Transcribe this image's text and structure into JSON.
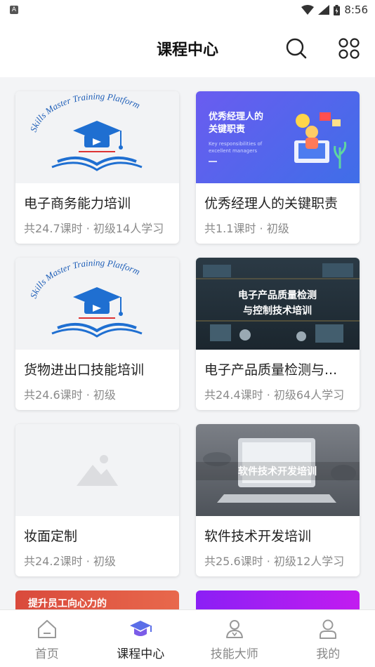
{
  "status_bar": {
    "time": "8:56",
    "left_icon": "A"
  },
  "header": {
    "title": "课程中心",
    "search_icon": "search-icon",
    "apps_icon": "grid-apps-icon"
  },
  "courses": [
    {
      "title": "电子商务能力培训",
      "meta": "共24.7课时 · 初级14人学习",
      "thumb": "skills-master-logo"
    },
    {
      "title": "优秀经理人的关键职责",
      "meta": "共1.1课时 · 初级",
      "thumb": "manager-banner",
      "thumb_text_1": "优秀经理人的",
      "thumb_text_2": "关键职责",
      "thumb_sub_1": "Key responsibilities of",
      "thumb_sub_2": "excellent managers"
    },
    {
      "title": "货物进出口技能培训",
      "meta": "共24.6课时 · 初级",
      "thumb": "skills-master-logo"
    },
    {
      "title": "电子产品质量检测与...",
      "meta": "共24.4课时 · 初级64人学习",
      "thumb": "circuit-board-banner",
      "thumb_text_1": "电子产品质量检测",
      "thumb_text_2": "与控制技术培训"
    },
    {
      "title": "妆面定制",
      "meta": "共24.2课时 · 初级",
      "thumb": "image-placeholder"
    },
    {
      "title": "软件技术开发培训",
      "meta": "共25.6课时 · 初级12人学习",
      "thumb": "laptop-banner",
      "thumb_text_1": "软件技术开发培训"
    }
  ],
  "logo_text": "Skills Master Training Platform",
  "peek_cards": [
    {
      "text": "提升员工向心力的"
    },
    {
      "text": ""
    }
  ],
  "tabs": [
    {
      "label": "首页",
      "icon": "home-icon",
      "active": false
    },
    {
      "label": "课程中心",
      "icon": "graduation-cap-icon",
      "active": true
    },
    {
      "label": "技能大师",
      "icon": "master-user-icon",
      "active": false
    },
    {
      "label": "我的",
      "icon": "profile-icon",
      "active": false
    }
  ],
  "colors": {
    "accent": "#4a5cd6",
    "logo_blue": "#1f6fd1",
    "text_primary": "#222222",
    "text_secondary": "#8a8a8a"
  }
}
